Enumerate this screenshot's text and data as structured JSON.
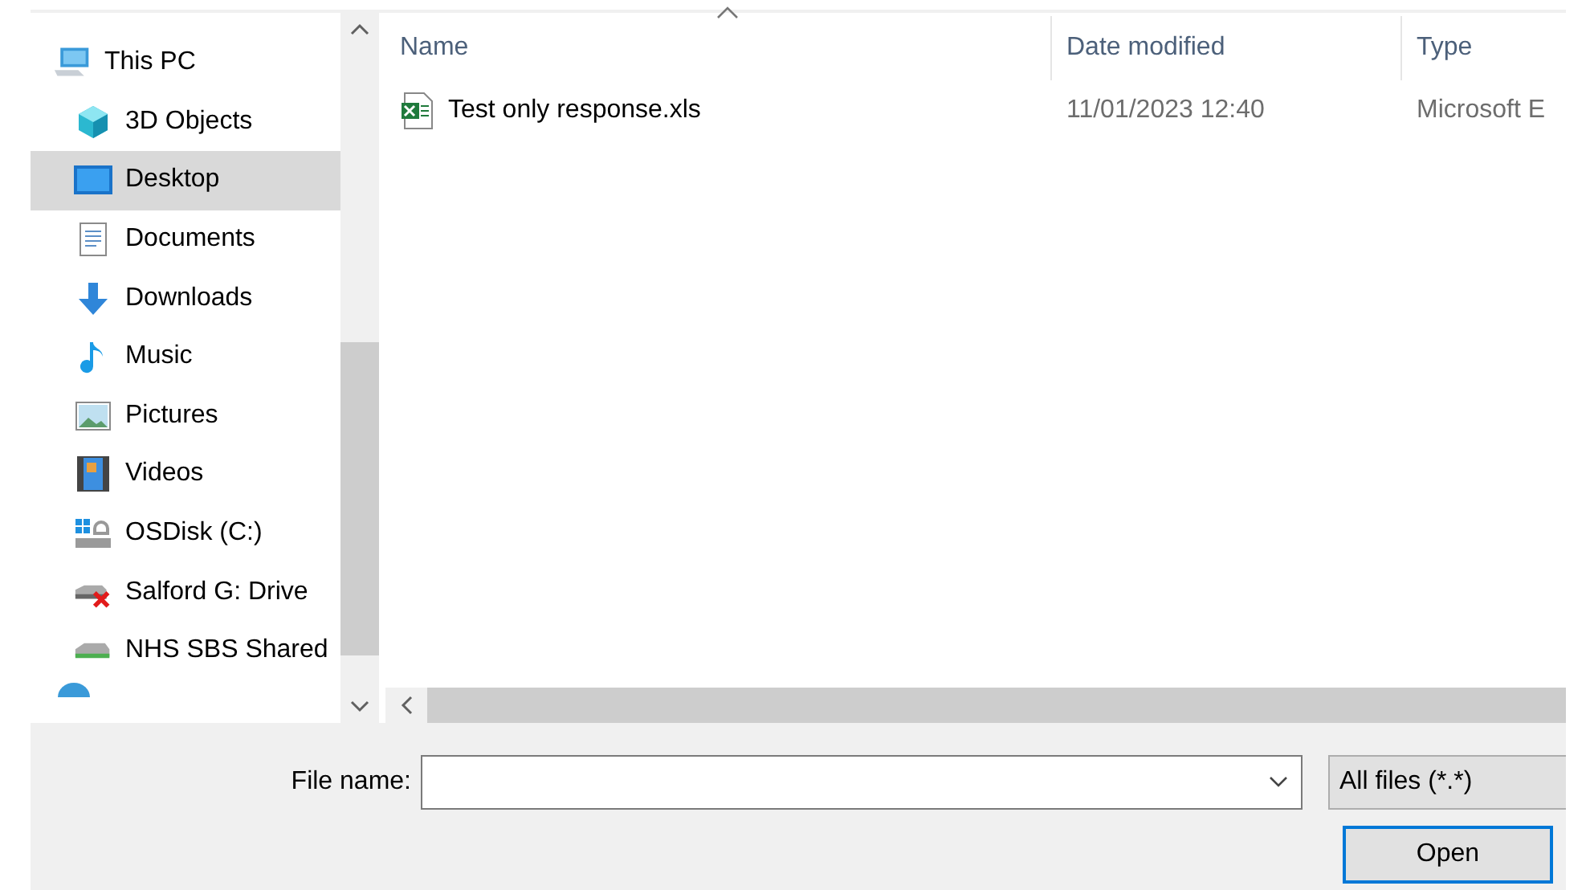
{
  "sidebar": {
    "items": [
      {
        "label": "This PC",
        "selected": false,
        "children": [
          {
            "label": "3D Objects",
            "selected": false
          },
          {
            "label": "Desktop",
            "selected": true
          },
          {
            "label": "Documents",
            "selected": false
          },
          {
            "label": "Downloads",
            "selected": false
          },
          {
            "label": "Music",
            "selected": false
          },
          {
            "label": "Pictures",
            "selected": false
          },
          {
            "label": "Videos",
            "selected": false
          },
          {
            "label": "OSDisk (C:)",
            "selected": false
          },
          {
            "label": "Salford G: Drive",
            "selected": false
          },
          {
            "label": "NHS SBS Shared",
            "selected": false
          }
        ]
      }
    ]
  },
  "file_list": {
    "columns": [
      "Name",
      "Date modified",
      "Type"
    ],
    "rows": [
      {
        "cells": [
          "Test only response.xls",
          "11/01/2023 12:40",
          "Microsoft E"
        ],
        "selected": false
      }
    ]
  },
  "footer": {
    "file_name_label": "File name:",
    "filter": "All files (*.*)",
    "open_button": "Open"
  }
}
